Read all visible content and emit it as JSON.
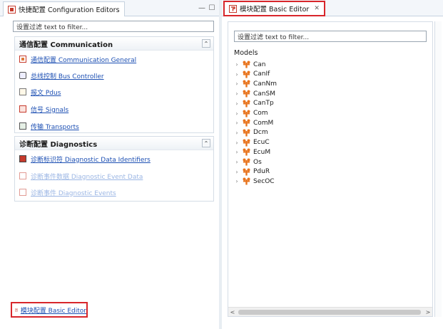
{
  "left_view": {
    "tab_title": "快捷配置 Configuration Editors",
    "minimize_glyph": "—",
    "maximize_glyph": "☐",
    "filter_value": "设置过滤 text to filter...",
    "sections": [
      {
        "title": "通信配置 Communication",
        "collapse_glyph": "⌃",
        "items": [
          {
            "label": "通信配置 Communication General",
            "icon": "communication-icon",
            "enabled": true
          },
          {
            "label": "总线控制 Bus Controller",
            "icon": "bus-controller-icon",
            "enabled": true
          },
          {
            "label": "报文 Pdus",
            "icon": "pdu-icon",
            "enabled": true
          },
          {
            "label": "信号 Signals",
            "icon": "signal-icon",
            "enabled": true
          },
          {
            "label": "传输 Transports",
            "icon": "transport-icon",
            "enabled": true
          }
        ]
      },
      {
        "title": "诊断配置 Diagnostics",
        "collapse_glyph": "⌃",
        "items": [
          {
            "label": "诊断标识符 Diagnostic Data Identifiers",
            "icon": "did-icon",
            "enabled": true
          },
          {
            "label": "诊断事件数据 Diagnostic Event Data",
            "icon": "event-data-icon",
            "enabled": false
          },
          {
            "label": "诊断事件 Diagnostic Events",
            "icon": "event-icon",
            "enabled": false
          }
        ]
      }
    ],
    "basic_editor_link": "模块配置 Basic Editor"
  },
  "right_view": {
    "tab_title": "模块配置 Basic Editor",
    "close_glyph": "✕",
    "filter_value": "设置过滤 text to filter...",
    "models_label": "Models",
    "models": [
      "Can",
      "CanIf",
      "CanNm",
      "CanSM",
      "CanTp",
      "Com",
      "ComM",
      "Dcm",
      "EcuC",
      "EcuM",
      "Os",
      "PduR",
      "SecOC"
    ],
    "scroll_left_glyph": "<",
    "scroll_right_glyph": ">"
  },
  "colors": {
    "highlight_red": "#d8262b",
    "link_blue": "#1c4fb3",
    "link_disabled": "#9bb6e4",
    "model_icon_orange": "#e8741e"
  }
}
